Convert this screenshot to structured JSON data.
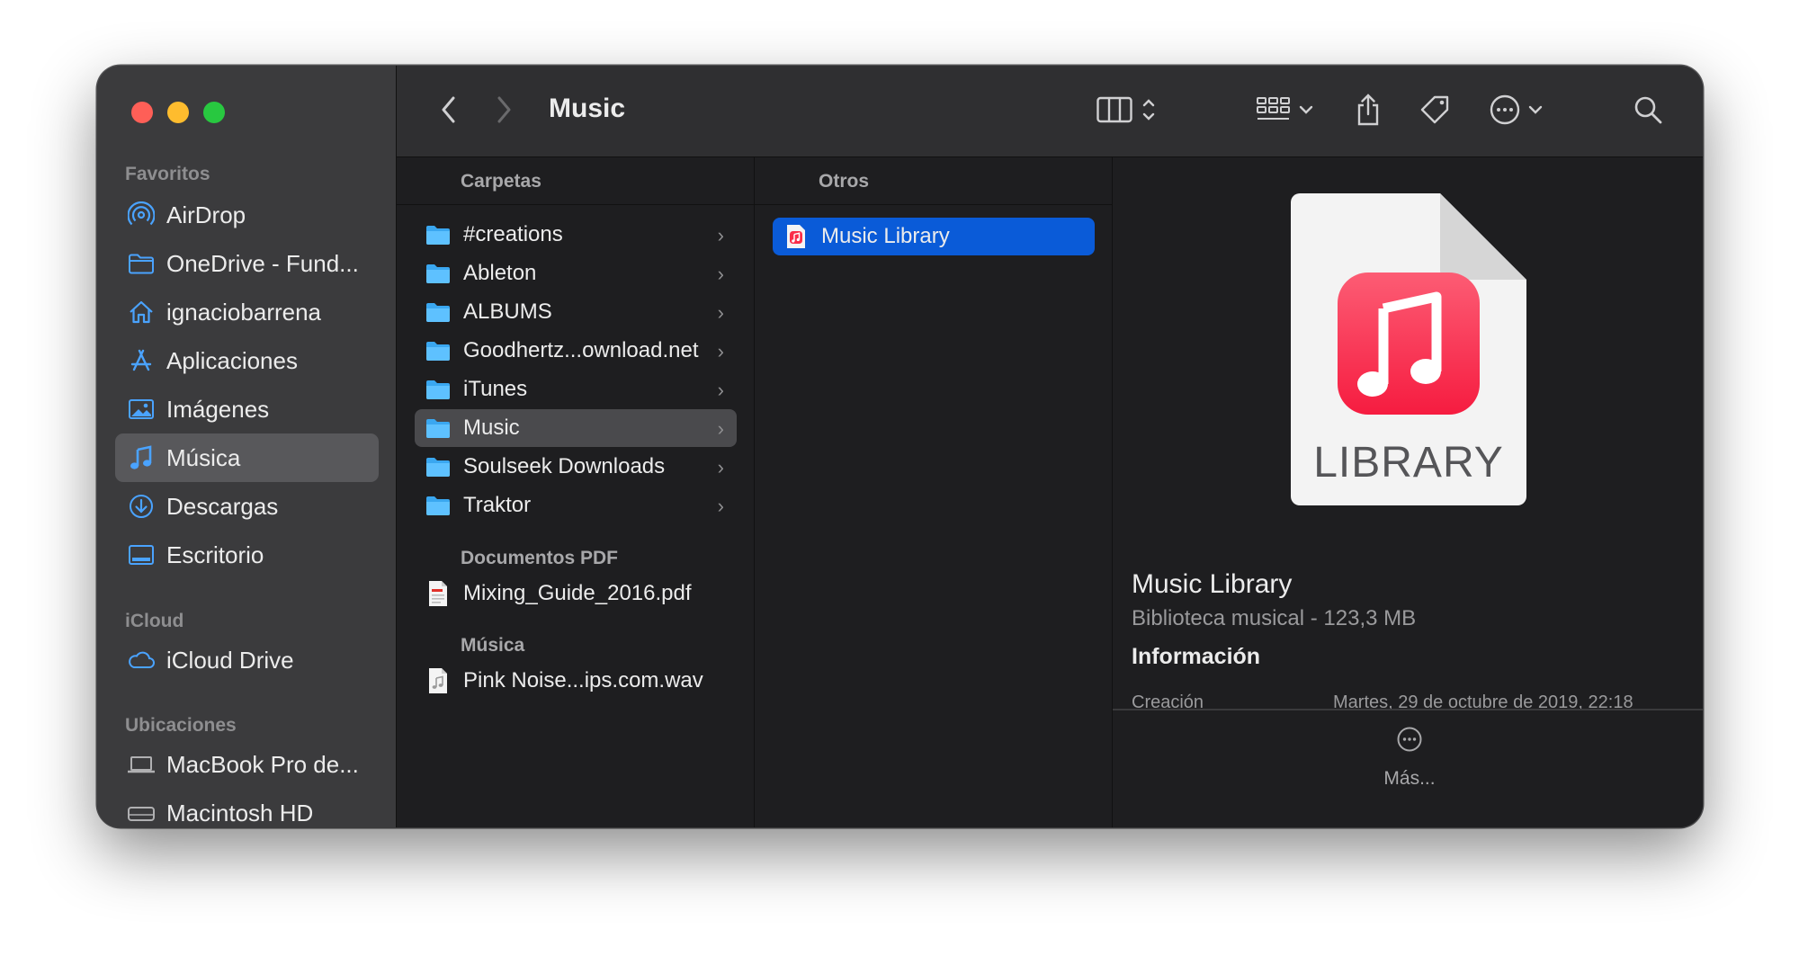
{
  "window": {
    "title": "Music"
  },
  "sidebar": {
    "sections": {
      "favorites": "Favoritos",
      "icloud": "iCloud",
      "locations": "Ubicaciones"
    },
    "favorites": [
      {
        "label": "AirDrop",
        "icon": "airdrop-icon"
      },
      {
        "label": "OneDrive - Fund...",
        "icon": "folder-icon"
      },
      {
        "label": "ignaciobarrena",
        "icon": "home-icon"
      },
      {
        "label": "Aplicaciones",
        "icon": "applications-icon"
      },
      {
        "label": "Imágenes",
        "icon": "photo-icon"
      },
      {
        "label": "Música",
        "icon": "music-note-icon",
        "selected": true
      },
      {
        "label": "Descargas",
        "icon": "download-icon"
      },
      {
        "label": "Escritorio",
        "icon": "desktop-icon"
      }
    ],
    "icloud": [
      {
        "label": "iCloud Drive",
        "icon": "cloud-icon"
      }
    ],
    "locations": [
      {
        "label": "MacBook Pro de...",
        "icon": "laptop-icon"
      },
      {
        "label": "Macintosh HD",
        "icon": "disk-icon"
      }
    ]
  },
  "toolbar": {
    "back": "‹",
    "forward": "›",
    "view_icon": "column-view-icon",
    "group_icon": "group-grid-icon",
    "share_icon": "share-icon",
    "tag_icon": "tag-icon",
    "action_icon": "more-actions-icon",
    "search_icon": "search-icon"
  },
  "column1": {
    "header": "Carpetas",
    "folders": [
      "#creations",
      "Ableton",
      "ALBUMS",
      "Goodhertz...ownload.net",
      "iTunes",
      "Music",
      "Soulseek Downloads",
      "Traktor"
    ],
    "selected_folder": "Music",
    "pdf_header": "Documentos PDF",
    "pdf_files": [
      "Mixing_Guide_2016.pdf"
    ],
    "music_header": "Música",
    "music_files": [
      "Pink Noise...ips.com.wav"
    ]
  },
  "column2": {
    "header": "Otros",
    "items": [
      "Music Library"
    ],
    "selected_item": "Music Library"
  },
  "preview": {
    "icon_label": "LIBRARY",
    "name": "Music Library",
    "subtitle": "Biblioteca musical - 123,3 MB",
    "info_heading": "Información",
    "creation_label": "Creación",
    "creation_value": "Martes, 29 de octubre de 2019, 22:18",
    "more_label": "Más..."
  },
  "colors": {
    "accent": "#0a5bd8",
    "folder": "#3aa7f0",
    "music_red": "#fa2d48",
    "sidebar_icon": "#4aa3ff"
  }
}
